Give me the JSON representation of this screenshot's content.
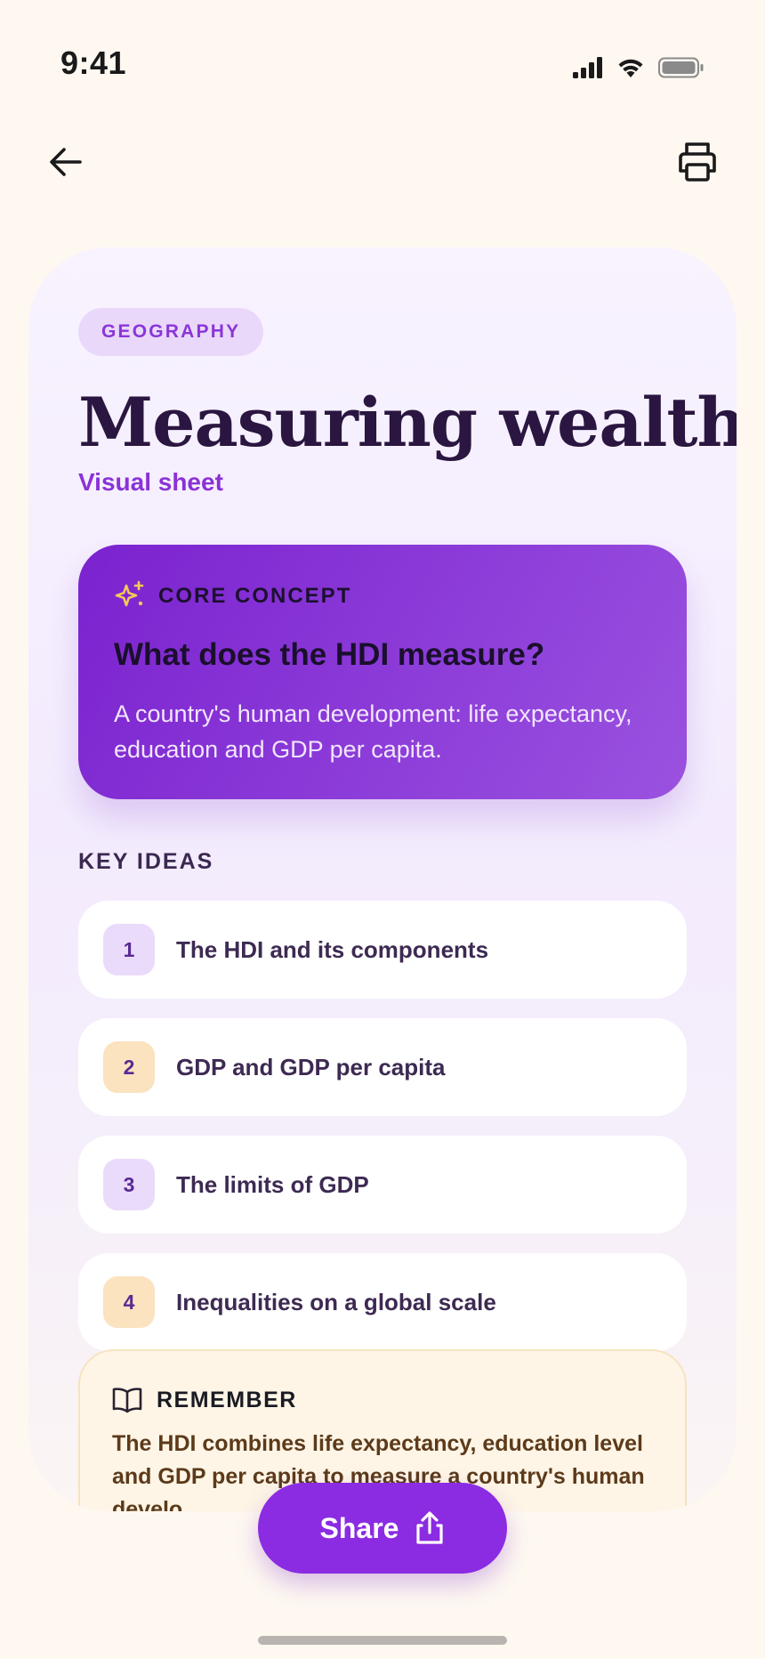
{
  "status_bar": {
    "time": "9:41"
  },
  "nav": {
    "back_icon": "arrow-left-icon",
    "print_icon": "printer-icon"
  },
  "sheet": {
    "tag": "GEOGRAPHY",
    "title": "Measuring wealth",
    "subtitle": "Visual sheet",
    "core_concept": {
      "label": "CORE CONCEPT",
      "icon": "sparkles-icon",
      "question": "What does the HDI measure?",
      "answer": "A country's human development: life expectancy, education and GDP per capita."
    },
    "key_ideas": {
      "label": "KEY IDEAS",
      "items": [
        {
          "number": "1",
          "text": "The HDI and its components"
        },
        {
          "number": "2",
          "text": "GDP and GDP per capita"
        },
        {
          "number": "3",
          "text": "The limits of GDP"
        },
        {
          "number": "4",
          "text": "Inequalities on a global scale"
        }
      ]
    },
    "remember": {
      "label": "REMEMBER",
      "icon": "book-open-icon",
      "text": "The HDI combines life expectancy, education level and GDP per capita to measure a country's human develo"
    }
  },
  "share_button": {
    "label": "Share",
    "icon": "share-icon"
  },
  "colors": {
    "accent": "#8b2be2",
    "background": "#fef8f1",
    "chip_bg": "#ead8fb",
    "amber": "#fbe3c0"
  }
}
